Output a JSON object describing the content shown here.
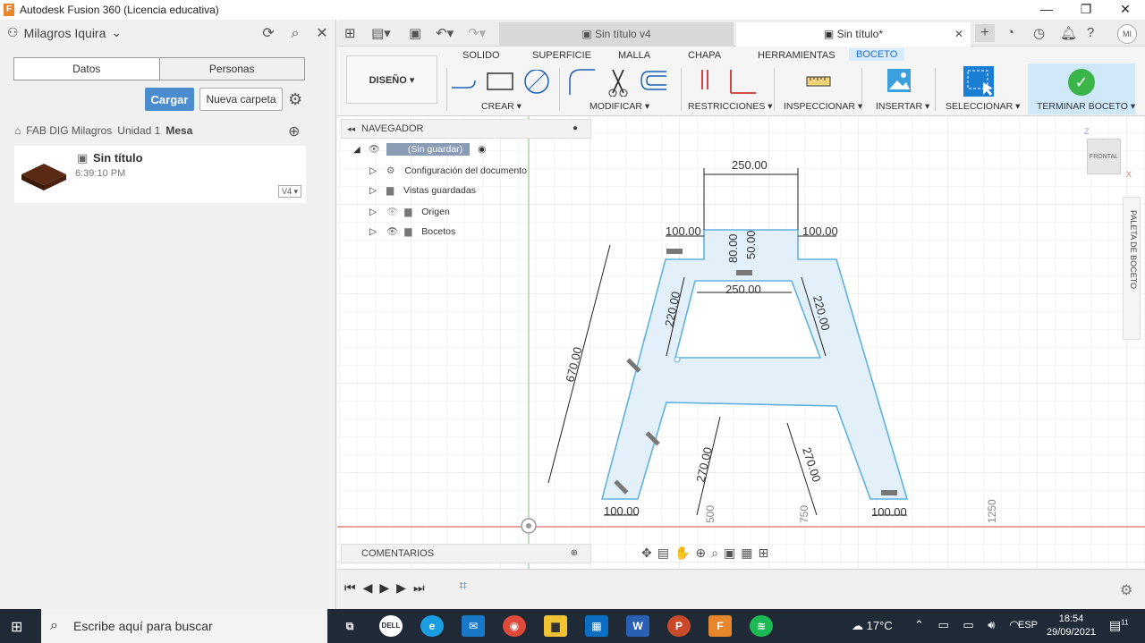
{
  "window": {
    "title": "Autodesk Fusion 360 (Licencia educativa)",
    "app_icon": "F",
    "minimize": "—",
    "maximize": "❐",
    "close": "✕"
  },
  "left_panel": {
    "user": "Milagros Iquira",
    "segments": [
      "Datos",
      "Personas"
    ],
    "upload_label": "Cargar",
    "new_folder_label": "Nueva carpeta",
    "breadcrumb": [
      "FAB DIG Milagros",
      "Unidad 1",
      "Mesa"
    ],
    "file": {
      "name": "Sin título",
      "time": "6:39:10 PM",
      "version": "V4 ▾"
    }
  },
  "tabs": [
    {
      "label": "Sin título v4"
    },
    {
      "label": "Sin título*"
    }
  ],
  "avatar": "MI",
  "toolbar": {
    "workspace": "DISEÑO ▾",
    "tabs": [
      "SOLIDO",
      "SUPERFICIE",
      "MALLA",
      "CHAPA",
      "HERRAMIENTAS",
      "BOCETO"
    ],
    "groups": [
      "CREAR ▾",
      "MODIFICAR ▾",
      "RESTRICCIONES ▾",
      "INSPECCIONAR ▾",
      "INSERTAR ▾",
      "SELECCIONAR ▾",
      "TERMINAR BOCETO ▾"
    ]
  },
  "navigator": {
    "title": "NAVEGADOR",
    "root": "(Sin guardar)",
    "items": [
      "Configuración del documento",
      "Vistas guardadas",
      "Origen",
      "Bocetos"
    ]
  },
  "comments_label": "COMENTARIOS",
  "palette_label": "PALETA DE BOCETO",
  "viewcube": {
    "face": "FRONTAL",
    "z": "Z",
    "x": "X"
  },
  "sketch": {
    "dims": [
      "250.00",
      "100.00",
      "100.00",
      "80.00",
      "50.00",
      "250.00",
      "220.00",
      "220.00",
      "670.00",
      "270.00",
      "270.00",
      "100.00",
      "100.00"
    ],
    "axis_labels": [
      "500",
      "750",
      "1250"
    ]
  },
  "taskbar": {
    "search_placeholder": "Escribe aquí para buscar",
    "temperature": "17°C",
    "language": "ESP",
    "time": "18:54",
    "date": "29/09/2021",
    "notifications": "11"
  }
}
